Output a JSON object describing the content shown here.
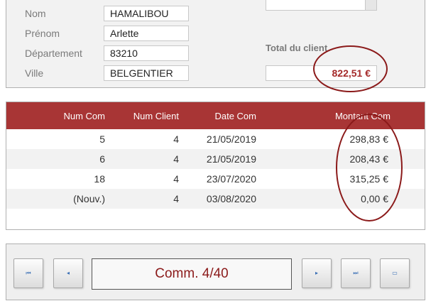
{
  "client": {
    "fields": [
      {
        "label": "Nom",
        "value": "HAMALIBOU"
      },
      {
        "label": "Prénom",
        "value": "Arlette"
      },
      {
        "label": "Département",
        "value": "83210"
      },
      {
        "label": "Ville",
        "value": "BELGENTIER"
      }
    ],
    "total_label": "Total du client",
    "total_value": "822,51 €"
  },
  "orders": {
    "headers": [
      "Num Com",
      "Num Client",
      "Date Com",
      "Montant Com"
    ],
    "rows": [
      [
        "5",
        "4",
        "21/05/2019",
        "298,83 €"
      ],
      [
        "6",
        "4",
        "21/05/2019",
        "208,43 €"
      ],
      [
        "18",
        "4",
        "23/07/2020",
        "315,25 €"
      ],
      [
        "(Nouv.)",
        "4",
        "03/08/2020",
        "0,00 €"
      ]
    ]
  },
  "navigation": {
    "counter": "Comm. 4/40",
    "buttons": [
      {
        "name": "first-record",
        "icon": "first-icon",
        "glyph": "⏮"
      },
      {
        "name": "previous-record",
        "icon": "previous-icon",
        "glyph": "◂"
      },
      {
        "name": "next-record",
        "icon": "next-icon",
        "glyph": "▸"
      },
      {
        "name": "last-record",
        "icon": "last-icon",
        "glyph": "⏭"
      },
      {
        "name": "new-record",
        "icon": "new-record-icon",
        "glyph": "▭"
      }
    ]
  },
  "colors": {
    "header_bg": "#a83535",
    "accent": "#a52a2a",
    "highlight": "#8b1a1a"
  }
}
